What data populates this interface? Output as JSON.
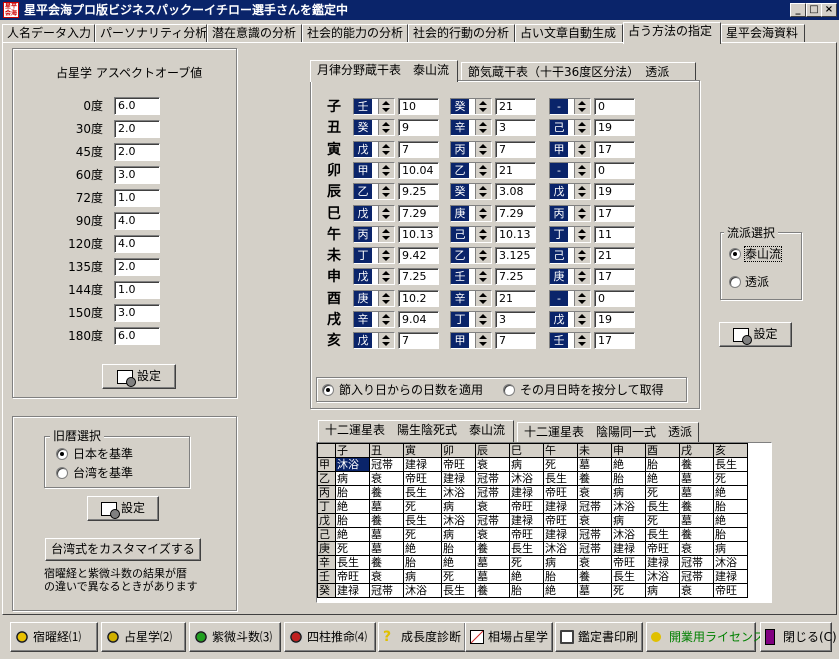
{
  "window": {
    "title": "星平会海プロ版ビジネスパックーイチロー選手さんを鑑定中",
    "icon_text": "星平会海"
  },
  "tabs": [
    "人名データ入力",
    "パーソナリティ分析",
    "潜在意識の分析",
    "社会的能力の分析",
    "社会的行動の分析",
    "占い文章自動生成",
    "占う方法の指定",
    "星平会海資料"
  ],
  "active_tab": 6,
  "aspect": {
    "title": "占星学 アスペクトオーブ値",
    "rows": [
      {
        "label": "0度",
        "value": "6.0"
      },
      {
        "label": "30度",
        "value": "2.0"
      },
      {
        "label": "45度",
        "value": "2.0"
      },
      {
        "label": "60度",
        "value": "3.0"
      },
      {
        "label": "72度",
        "value": "1.0"
      },
      {
        "label": "90度",
        "value": "4.0"
      },
      {
        "label": "120度",
        "value": "4.0"
      },
      {
        "label": "135度",
        "value": "2.0"
      },
      {
        "label": "144度",
        "value": "1.0"
      },
      {
        "label": "150度",
        "value": "3.0"
      },
      {
        "label": "180度",
        "value": "6.0"
      }
    ],
    "set_button": "設定"
  },
  "calendar": {
    "group_title": "旧暦選択",
    "options": [
      "日本を基準",
      "台湾を基準"
    ],
    "selected": 0,
    "set_button": "設定",
    "customize_button": "台湾式をカスタマイズする",
    "note_line1": "宿曜経と紫微斗数の結果が暦",
    "note_line2": "の違いで異なるときがあります"
  },
  "zokan": {
    "tabs": [
      "月律分野蔵干表　泰山流",
      "節気蔵干表（十干36度区分法）　透派"
    ],
    "rows": [
      {
        "branch": "子",
        "c": [
          {
            "s": "壬",
            "v": "10"
          },
          {
            "s": "癸",
            "v": "21"
          },
          {
            "s": "-",
            "v": "0"
          }
        ]
      },
      {
        "branch": "丑",
        "c": [
          {
            "s": "癸",
            "v": "9"
          },
          {
            "s": "辛",
            "v": "3"
          },
          {
            "s": "己",
            "v": "19"
          }
        ]
      },
      {
        "branch": "寅",
        "c": [
          {
            "s": "戊",
            "v": "7"
          },
          {
            "s": "丙",
            "v": "7"
          },
          {
            "s": "甲",
            "v": "17"
          }
        ]
      },
      {
        "branch": "卯",
        "c": [
          {
            "s": "甲",
            "v": "10.04"
          },
          {
            "s": "乙",
            "v": "21"
          },
          {
            "s": "-",
            "v": "0"
          }
        ]
      },
      {
        "branch": "辰",
        "c": [
          {
            "s": "乙",
            "v": "9.25"
          },
          {
            "s": "癸",
            "v": "3.08"
          },
          {
            "s": "戊",
            "v": "19"
          }
        ]
      },
      {
        "branch": "巳",
        "c": [
          {
            "s": "戊",
            "v": "7.29"
          },
          {
            "s": "庚",
            "v": "7.29"
          },
          {
            "s": "丙",
            "v": "17"
          }
        ]
      },
      {
        "branch": "午",
        "c": [
          {
            "s": "丙",
            "v": "10.13"
          },
          {
            "s": "己",
            "v": "10.13"
          },
          {
            "s": "丁",
            "v": "11"
          }
        ]
      },
      {
        "branch": "未",
        "c": [
          {
            "s": "丁",
            "v": "9.42"
          },
          {
            "s": "乙",
            "v": "3.125"
          },
          {
            "s": "己",
            "v": "21"
          }
        ]
      },
      {
        "branch": "申",
        "c": [
          {
            "s": "戊",
            "v": "7.25"
          },
          {
            "s": "壬",
            "v": "7.25"
          },
          {
            "s": "庚",
            "v": "17"
          }
        ]
      },
      {
        "branch": "酉",
        "c": [
          {
            "s": "庚",
            "v": "10.2"
          },
          {
            "s": "辛",
            "v": "21"
          },
          {
            "s": "-",
            "v": "0"
          }
        ]
      },
      {
        "branch": "戌",
        "c": [
          {
            "s": "辛",
            "v": "9.04"
          },
          {
            "s": "丁",
            "v": "3"
          },
          {
            "s": "戊",
            "v": "19"
          }
        ]
      },
      {
        "branch": "亥",
        "c": [
          {
            "s": "戊",
            "v": "7"
          },
          {
            "s": "甲",
            "v": "7"
          },
          {
            "s": "壬",
            "v": "17"
          }
        ]
      }
    ],
    "options": [
      "節入り日からの日数を適用",
      "その月日時を按分して取得"
    ],
    "selected": 0
  },
  "school": {
    "group_title": "流派選択",
    "options": [
      "泰山流",
      "透派"
    ],
    "selected": 0,
    "set_button": "設定"
  },
  "unsei": {
    "tabs": [
      "十二運星表　陽生陰死式　泰山流",
      "十二運星表　陰陽同一式　透派"
    ],
    "headers": [
      "",
      "子",
      "丑",
      "寅",
      "卯",
      "辰",
      "巳",
      "午",
      "未",
      "申",
      "酉",
      "戌",
      "亥"
    ],
    "rows": [
      [
        "甲",
        "沐浴",
        "冠帯",
        "建禄",
        "帝旺",
        "衰",
        "病",
        "死",
        "墓",
        "絶",
        "胎",
        "養",
        "長生"
      ],
      [
        "乙",
        "病",
        "衰",
        "帝旺",
        "建禄",
        "冠帯",
        "沐浴",
        "長生",
        "養",
        "胎",
        "絶",
        "墓",
        "死"
      ],
      [
        "丙",
        "胎",
        "養",
        "長生",
        "沐浴",
        "冠帯",
        "建禄",
        "帝旺",
        "衰",
        "病",
        "死",
        "墓",
        "絶"
      ],
      [
        "丁",
        "絶",
        "墓",
        "死",
        "病",
        "衰",
        "帝旺",
        "建禄",
        "冠帯",
        "沐浴",
        "長生",
        "養",
        "胎"
      ],
      [
        "戊",
        "胎",
        "養",
        "長生",
        "沐浴",
        "冠帯",
        "建禄",
        "帝旺",
        "衰",
        "病",
        "死",
        "墓",
        "絶"
      ],
      [
        "己",
        "絶",
        "墓",
        "死",
        "病",
        "衰",
        "帝旺",
        "建禄",
        "冠帯",
        "沐浴",
        "長生",
        "養",
        "胎"
      ],
      [
        "庚",
        "死",
        "墓",
        "絶",
        "胎",
        "養",
        "長生",
        "沐浴",
        "冠帯",
        "建禄",
        "帝旺",
        "衰",
        "病"
      ],
      [
        "辛",
        "長生",
        "養",
        "胎",
        "絶",
        "墓",
        "死",
        "病",
        "衰",
        "帝旺",
        "建禄",
        "冠帯",
        "沐浴"
      ],
      [
        "壬",
        "帝旺",
        "衰",
        "病",
        "死",
        "墓",
        "絶",
        "胎",
        "養",
        "長生",
        "沐浴",
        "冠帯",
        "建禄"
      ],
      [
        "癸",
        "建禄",
        "冠帯",
        "沐浴",
        "長生",
        "養",
        "胎",
        "絶",
        "墓",
        "死",
        "病",
        "衰",
        "帝旺"
      ]
    ]
  },
  "bottom": [
    {
      "label": "宿曜経⑴",
      "icon": "yellow-circle-icon",
      "color": "#e8c000"
    },
    {
      "label": "占星学⑵",
      "icon": "yellow-circle-icon",
      "color": "#d0b000"
    },
    {
      "label": "紫微斗数⑶",
      "icon": "green-circle-icon",
      "color": "#20a020"
    },
    {
      "label": "四柱推命⑷",
      "icon": "red-circle-icon",
      "color": "#c02020"
    },
    {
      "label": "成長度診断",
      "icon": "question-icon",
      "color": "#e0c000"
    },
    {
      "label": "相場占星学",
      "icon": "chart-icon",
      "color": "#c00000"
    },
    {
      "label": "鑑定書印刷",
      "icon": "printer-icon",
      "color": "#404040"
    },
    {
      "label": "開業用ライセンス",
      "icon": "key-icon",
      "color": "#e0c000",
      "text_color": "#008000"
    },
    {
      "label": "閉じる(C)",
      "icon": "door-icon",
      "color": "#800080"
    }
  ]
}
